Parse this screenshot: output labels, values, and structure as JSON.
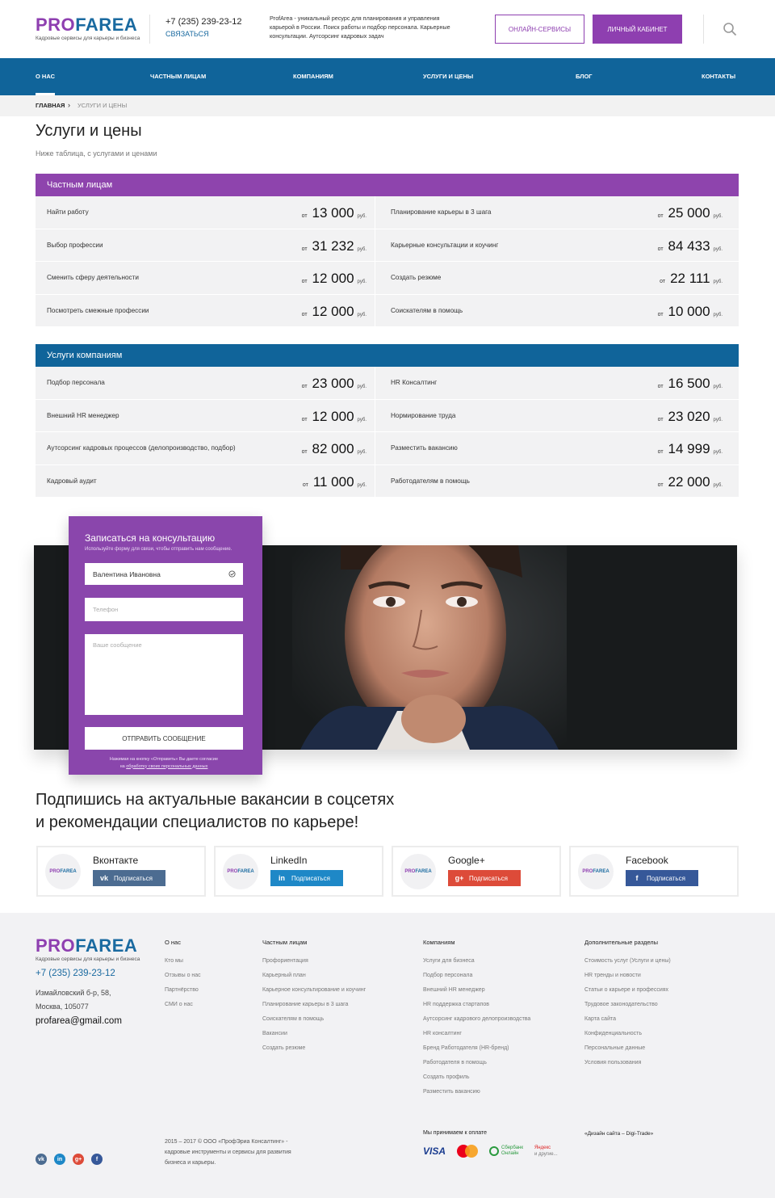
{
  "header": {
    "logo_part1": "PRO",
    "logo_part2": "FAREA",
    "logo_tagline": "Кадровые сервисы для карьеры и бизнеса",
    "phone": "+7 (235) 239-23-12",
    "contact_link": "Связаться",
    "about": "ProfArea - уникальный ресурс для планирования и управления карьерой в России. Поиск работы и подбор персонала. Карьерные консультации. Аутсорсинг кадровых задач",
    "online_button": "Онлайн-сервисы",
    "cabinet_button": "Личный кабинет",
    "search_icon": "search-icon"
  },
  "nav": {
    "items": [
      {
        "label": "О нас"
      },
      {
        "label": "Частным лицам"
      },
      {
        "label": "Компаниям"
      },
      {
        "label": "Услуги и цены"
      },
      {
        "label": "Блог"
      },
      {
        "label": "Контакты"
      }
    ],
    "active_index": 0
  },
  "breadcrumb": {
    "home": "Главная",
    "separator": "›",
    "current": "Услуги и цены"
  },
  "page": {
    "title": "Услуги и цены",
    "subtitle": "Ниже таблица, с услугами и ценами"
  },
  "price_labels": {
    "from": "от",
    "currency": "руб."
  },
  "tables": [
    {
      "title": "Частным лицам",
      "color": "#8e44ad",
      "rows": [
        {
          "name": "Найти работу",
          "price": "13 000"
        },
        {
          "name": "Планирование карьеры в 3 шага",
          "price": "25 000"
        },
        {
          "name": "Выбор профессии",
          "price": "31 232"
        },
        {
          "name": "Карьерные консультации и коучинг",
          "price": "84 433"
        },
        {
          "name": "Сменить сферу деятельности",
          "price": "12 000"
        },
        {
          "name": "Создать резюме",
          "price": "22 111"
        },
        {
          "name": "Посмотреть смежные профессии",
          "price": "12 000"
        },
        {
          "name": "Соискателям в помощь",
          "price": "10 000"
        }
      ]
    },
    {
      "title": "Услуги компаниям",
      "color": "#10649a",
      "rows": [
        {
          "name": "Подбор персонала",
          "price": "23 000"
        },
        {
          "name": "HR Консалтинг",
          "price": "16 500"
        },
        {
          "name": "Внешний HR менеджер",
          "price": "12 000"
        },
        {
          "name": "Нормирование труда",
          "price": "23 020"
        },
        {
          "name": "Аутсорсинг кадровых процессов (делопроизводство, подбор)",
          "price": "82 000"
        },
        {
          "name": "Разместить вакансию",
          "price": "14 999"
        },
        {
          "name": "Кадровый аудит",
          "price": "11 000"
        },
        {
          "name": "Работодателям в помощь",
          "price": "22 000"
        }
      ]
    }
  ],
  "consult_form": {
    "title": "Записаться на консультацию",
    "hint": "Используйте форму для связи, чтобы отправить нам сообщение.",
    "name_value": "Валентина Ивановна",
    "phone_placeholder": "Телефон",
    "message_placeholder": "Ваше сообщение",
    "submit": "Отправить сообщение",
    "note_line1": "Нажимая на кнопку «Отправить» Вы даете согласие",
    "note_prefix": "на ",
    "note_link": "обработку своих персональных данных"
  },
  "subscribe": {
    "title_line1": "Подпишись на актуальные вакансии в соцсетях",
    "title_line2": "и рекомендации специалистов по карьере!",
    "button_label": "Подписаться",
    "cards": [
      {
        "name": "Вконтакте",
        "icon": "vk-icon",
        "glyph": "vk",
        "color": "#4c6c91"
      },
      {
        "name": "LinkedIn",
        "icon": "linkedin-icon",
        "glyph": "in",
        "color": "#1e88c7"
      },
      {
        "name": "Google+",
        "icon": "google-plus-icon",
        "glyph": "g+",
        "color": "#dd4b39"
      },
      {
        "name": "Facebook",
        "icon": "facebook-icon",
        "glyph": "f",
        "color": "#365899"
      }
    ]
  },
  "footer": {
    "phone": "+7 (235) 239-23-12",
    "address_line1": "Измайловский б-р, 58,",
    "address_line2": "Москва, 105077",
    "email": "profarea@gmail.com",
    "columns": [
      {
        "title": "О нас",
        "links": [
          "Кто мы",
          "Отзывы о нас",
          "Партнёрство",
          "СМИ о нас"
        ]
      },
      {
        "title": "Частным лицам",
        "links": [
          "Профориентация",
          "Карьерный план",
          "Карьерное консультирование и коучинг",
          "Планирование карьеры в 3 шага",
          "Соискателям в помощь",
          "Вакансии",
          "Создать резюме"
        ]
      },
      {
        "title": "Компаниям",
        "links": [
          "Услуги для бизнеса",
          "Подбор персонала",
          "Внешний HR менеджер",
          "HR поддержка стартапов",
          "Аутсорсинг кадрового делопроизводства",
          "HR консалтинг",
          "Бренд Работодателя (HR-бренд)",
          "Работодателя в помощь",
          "Создать профиль",
          "Разместить вакансию"
        ]
      },
      {
        "title": "Дополнительные разделы",
        "links": [
          "Стоимость услуг (Услуги и цены)",
          "HR тренды и новости",
          "Статьи о карьере и профессиях",
          "Трудовое законодательство",
          "Карта сайта",
          "Конфиденциальность",
          "Персональные данные",
          "Условия пользования"
        ]
      }
    ],
    "copyright": "2015 – 2017 © ООО «ПрофЭриа Консалтинг» - кадровые инструменты и сервисы для развития бизнеса и карьеры.",
    "payment_title": "Мы принимаем к оплате",
    "pay_visa": "VISA",
    "pay_sber_1": "Сбербанк",
    "pay_sber_2": "Онлайн",
    "pay_yandex_1": "Яндекс",
    "pay_yandex_2": "и другие...",
    "design_credit": "«Дизайн сайта – Digi-Trade»",
    "social": [
      {
        "icon": "vk-icon",
        "glyph": "vk",
        "color": "#4c6c91"
      },
      {
        "icon": "linkedin-icon",
        "glyph": "in",
        "color": "#1e88c7"
      },
      {
        "icon": "google-plus-icon",
        "glyph": "g+",
        "color": "#dd4b39"
      },
      {
        "icon": "facebook-icon",
        "glyph": "f",
        "color": "#365899"
      }
    ]
  }
}
